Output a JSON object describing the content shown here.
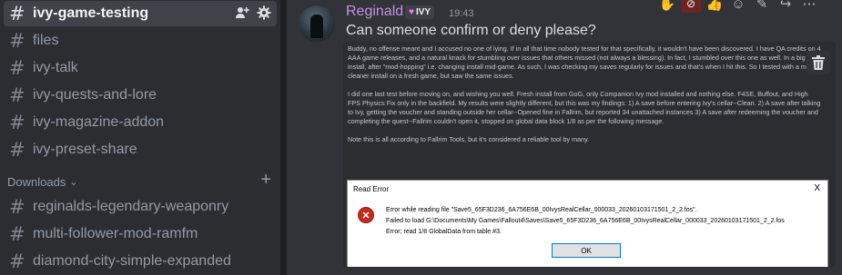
{
  "sidebar": {
    "channels": [
      {
        "label": "ivy-game-testing",
        "active": true
      },
      {
        "label": "files"
      },
      {
        "label": "ivy-talk"
      },
      {
        "label": "ivy-quests-and-lore"
      },
      {
        "label": "ivy-magazine-addon"
      },
      {
        "label": "ivy-preset-share"
      }
    ],
    "category": {
      "label": "Downloads",
      "chevron_icon": "chevron-down-icon",
      "add_icon": "plus-icon"
    },
    "download_channels": [
      {
        "label": "reginalds-legendary-weaponry"
      },
      {
        "label": "multi-follower-mod-ramfm"
      },
      {
        "label": "diamond-city-simple-expanded"
      }
    ],
    "hash_glyph": "#",
    "active_icons": [
      "add-member-icon",
      "gear-icon"
    ]
  },
  "message": {
    "username": "Reginald",
    "tag": "IVY",
    "timestamp": "19:43",
    "text": "Can someone confirm or deny please?",
    "username_color": "#c990e8"
  },
  "toolbar": {
    "icons": [
      "hand-emoji-icon",
      "blocked-emoji-icon",
      "thumbs-emoji-icon",
      "add-reaction-icon",
      "edit-icon",
      "reply-icon",
      "more-icon"
    ]
  },
  "attachment": {
    "paragraphs": [
      "Buddy, no offense meant and I accused no one of lying. If in all that time nobody tested for that specifically, it wouldn't have been discovered. I have QA credits on 4 AAA game releases, and a natural knack for stumbling over issues that others missed (not always a blessing). In fact, I stumbled over this one as well. In a big install, after \"mod-hopping\" i.e. changing install mid-game. As such, I was checking my saves regularly for issues and that's when I hit this. So I tested with a much cleaner install on a fresh game, but saw the same issues.",
      "I did one last test before moving on, and wishing you well. Fresh install from GoG, only Companion Ivy mod installed and nothing else. F4SE, Buffout, and High FPS Physics Fix only in the backfield. My results were slightly different, but this was my findings: 1) A save before entering Ivy's cellar--Clean. 2) A save after talking to Ivy, getting the voucher and standing outside her cellar--Opened fine in Fallrim, but reported 34 unattached instances 3) A save after redeeming the voucher and completing the quest--Fallrim couldn't open it, stopped on global data block 1/8 as per the following message.",
      "Note this is all according to Fallrim Tools, but it's considered a reliable tool by many."
    ],
    "delete_icon": "trash-icon"
  },
  "dialog": {
    "title": "Read Error",
    "close": "X",
    "lines": [
      "Error while reading file \"Save5_65F3D236_6A756E6B_00IvysRealCellar_000033_20260103171501_2_2.fos\".",
      "Failed to load G:\\Documents\\My Games\\Fallout4\\Saves\\Save5_65F3D236_6A756E6B_00IvysRealCellar_000033_20260103171501_2_2.fos",
      "Error; read 1/8 GlobalData from table #3."
    ],
    "ok_label": "OK",
    "icon": "error-icon"
  }
}
